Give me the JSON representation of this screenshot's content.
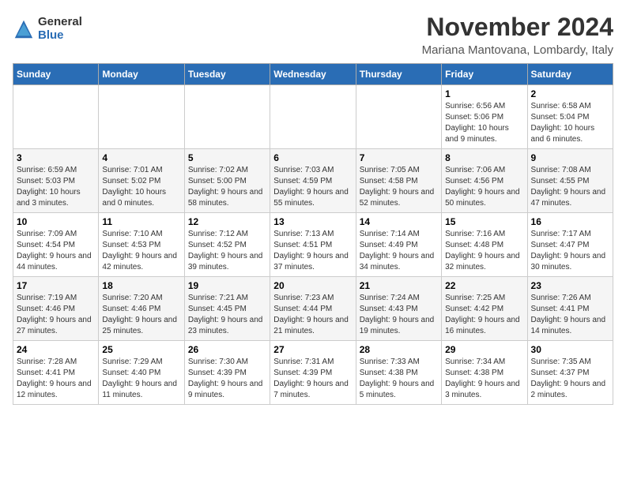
{
  "logo": {
    "general": "General",
    "blue": "Blue"
  },
  "title": "November 2024",
  "location": "Mariana Mantovana, Lombardy, Italy",
  "days_of_week": [
    "Sunday",
    "Monday",
    "Tuesday",
    "Wednesday",
    "Thursday",
    "Friday",
    "Saturday"
  ],
  "weeks": [
    [
      {
        "day": "",
        "info": ""
      },
      {
        "day": "",
        "info": ""
      },
      {
        "day": "",
        "info": ""
      },
      {
        "day": "",
        "info": ""
      },
      {
        "day": "",
        "info": ""
      },
      {
        "day": "1",
        "info": "Sunrise: 6:56 AM\nSunset: 5:06 PM\nDaylight: 10 hours and 9 minutes."
      },
      {
        "day": "2",
        "info": "Sunrise: 6:58 AM\nSunset: 5:04 PM\nDaylight: 10 hours and 6 minutes."
      }
    ],
    [
      {
        "day": "3",
        "info": "Sunrise: 6:59 AM\nSunset: 5:03 PM\nDaylight: 10 hours and 3 minutes."
      },
      {
        "day": "4",
        "info": "Sunrise: 7:01 AM\nSunset: 5:02 PM\nDaylight: 10 hours and 0 minutes."
      },
      {
        "day": "5",
        "info": "Sunrise: 7:02 AM\nSunset: 5:00 PM\nDaylight: 9 hours and 58 minutes."
      },
      {
        "day": "6",
        "info": "Sunrise: 7:03 AM\nSunset: 4:59 PM\nDaylight: 9 hours and 55 minutes."
      },
      {
        "day": "7",
        "info": "Sunrise: 7:05 AM\nSunset: 4:58 PM\nDaylight: 9 hours and 52 minutes."
      },
      {
        "day": "8",
        "info": "Sunrise: 7:06 AM\nSunset: 4:56 PM\nDaylight: 9 hours and 50 minutes."
      },
      {
        "day": "9",
        "info": "Sunrise: 7:08 AM\nSunset: 4:55 PM\nDaylight: 9 hours and 47 minutes."
      }
    ],
    [
      {
        "day": "10",
        "info": "Sunrise: 7:09 AM\nSunset: 4:54 PM\nDaylight: 9 hours and 44 minutes."
      },
      {
        "day": "11",
        "info": "Sunrise: 7:10 AM\nSunset: 4:53 PM\nDaylight: 9 hours and 42 minutes."
      },
      {
        "day": "12",
        "info": "Sunrise: 7:12 AM\nSunset: 4:52 PM\nDaylight: 9 hours and 39 minutes."
      },
      {
        "day": "13",
        "info": "Sunrise: 7:13 AM\nSunset: 4:51 PM\nDaylight: 9 hours and 37 minutes."
      },
      {
        "day": "14",
        "info": "Sunrise: 7:14 AM\nSunset: 4:49 PM\nDaylight: 9 hours and 34 minutes."
      },
      {
        "day": "15",
        "info": "Sunrise: 7:16 AM\nSunset: 4:48 PM\nDaylight: 9 hours and 32 minutes."
      },
      {
        "day": "16",
        "info": "Sunrise: 7:17 AM\nSunset: 4:47 PM\nDaylight: 9 hours and 30 minutes."
      }
    ],
    [
      {
        "day": "17",
        "info": "Sunrise: 7:19 AM\nSunset: 4:46 PM\nDaylight: 9 hours and 27 minutes."
      },
      {
        "day": "18",
        "info": "Sunrise: 7:20 AM\nSunset: 4:46 PM\nDaylight: 9 hours and 25 minutes."
      },
      {
        "day": "19",
        "info": "Sunrise: 7:21 AM\nSunset: 4:45 PM\nDaylight: 9 hours and 23 minutes."
      },
      {
        "day": "20",
        "info": "Sunrise: 7:23 AM\nSunset: 4:44 PM\nDaylight: 9 hours and 21 minutes."
      },
      {
        "day": "21",
        "info": "Sunrise: 7:24 AM\nSunset: 4:43 PM\nDaylight: 9 hours and 19 minutes."
      },
      {
        "day": "22",
        "info": "Sunrise: 7:25 AM\nSunset: 4:42 PM\nDaylight: 9 hours and 16 minutes."
      },
      {
        "day": "23",
        "info": "Sunrise: 7:26 AM\nSunset: 4:41 PM\nDaylight: 9 hours and 14 minutes."
      }
    ],
    [
      {
        "day": "24",
        "info": "Sunrise: 7:28 AM\nSunset: 4:41 PM\nDaylight: 9 hours and 12 minutes."
      },
      {
        "day": "25",
        "info": "Sunrise: 7:29 AM\nSunset: 4:40 PM\nDaylight: 9 hours and 11 minutes."
      },
      {
        "day": "26",
        "info": "Sunrise: 7:30 AM\nSunset: 4:39 PM\nDaylight: 9 hours and 9 minutes."
      },
      {
        "day": "27",
        "info": "Sunrise: 7:31 AM\nSunset: 4:39 PM\nDaylight: 9 hours and 7 minutes."
      },
      {
        "day": "28",
        "info": "Sunrise: 7:33 AM\nSunset: 4:38 PM\nDaylight: 9 hours and 5 minutes."
      },
      {
        "day": "29",
        "info": "Sunrise: 7:34 AM\nSunset: 4:38 PM\nDaylight: 9 hours and 3 minutes."
      },
      {
        "day": "30",
        "info": "Sunrise: 7:35 AM\nSunset: 4:37 PM\nDaylight: 9 hours and 2 minutes."
      }
    ]
  ]
}
